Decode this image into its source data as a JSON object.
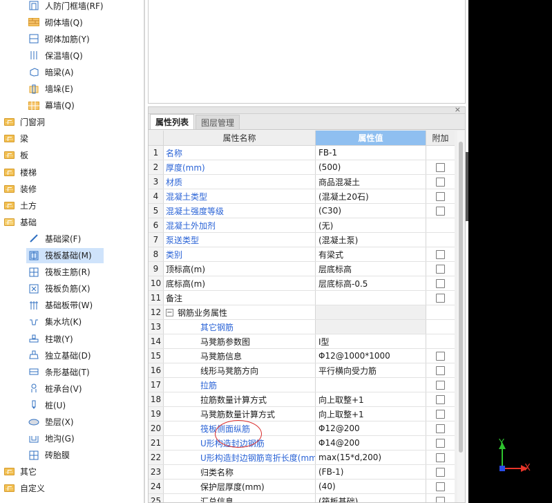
{
  "tree": {
    "items": [
      {
        "label": "人防门框墙(RF)",
        "icon": "door-frame-wall-icon",
        "level": 2
      },
      {
        "label": "砌体墙(Q)",
        "icon": "brick-wall-icon",
        "level": 2
      },
      {
        "label": "砌体加筋(Y)",
        "icon": "masonry-rebar-icon",
        "level": 2
      },
      {
        "label": "保温墙(Q)",
        "icon": "insulation-wall-icon",
        "level": 2
      },
      {
        "label": "暗梁(A)",
        "icon": "hidden-beam-icon",
        "level": 2
      },
      {
        "label": "墙垛(E)",
        "icon": "wall-pier-icon",
        "level": 2
      },
      {
        "label": "幕墙(Q)",
        "icon": "curtain-wall-icon",
        "level": 2
      },
      {
        "label": "门窗洞",
        "icon": "folder-icon",
        "level": 1
      },
      {
        "label": "梁",
        "icon": "folder-icon",
        "level": 1
      },
      {
        "label": "板",
        "icon": "folder-icon",
        "level": 1
      },
      {
        "label": "楼梯",
        "icon": "folder-icon",
        "level": 1
      },
      {
        "label": "装修",
        "icon": "folder-icon",
        "level": 1
      },
      {
        "label": "土方",
        "icon": "folder-icon",
        "level": 1
      },
      {
        "label": "基础",
        "icon": "folder-open-icon",
        "level": 1
      },
      {
        "label": "基础梁(F)",
        "icon": "foundation-beam-icon",
        "level": 2
      },
      {
        "label": "筏板基础(M)",
        "icon": "raft-foundation-icon",
        "level": 2,
        "selected": true
      },
      {
        "label": "筏板主筋(R)",
        "icon": "raft-main-rebar-icon",
        "level": 2
      },
      {
        "label": "筏板负筋(X)",
        "icon": "raft-negative-rebar-icon",
        "level": 2
      },
      {
        "label": "基础板带(W)",
        "icon": "foundation-strip-icon",
        "level": 2
      },
      {
        "label": "集水坑(K)",
        "icon": "sump-pit-icon",
        "level": 2
      },
      {
        "label": "柱墩(Y)",
        "icon": "column-pier-icon",
        "level": 2
      },
      {
        "label": "独立基础(D)",
        "icon": "isolated-footing-icon",
        "level": 2
      },
      {
        "label": "条形基础(T)",
        "icon": "strip-footing-icon",
        "level": 2
      },
      {
        "label": "桩承台(V)",
        "icon": "pile-cap-icon",
        "level": 2
      },
      {
        "label": "桩(U)",
        "icon": "pile-icon",
        "level": 2
      },
      {
        "label": "垫层(X)",
        "icon": "cushion-layer-icon",
        "level": 2
      },
      {
        "label": "地沟(G)",
        "icon": "trench-icon",
        "level": 2
      },
      {
        "label": "砖胎膜",
        "icon": "brick-mold-icon",
        "level": 2
      },
      {
        "label": "其它",
        "icon": "folder-icon",
        "level": 1
      },
      {
        "label": "自定义",
        "icon": "folder-icon",
        "level": 1
      }
    ]
  },
  "panel": {
    "close_label": "×",
    "tabs": [
      {
        "label": "属性列表",
        "active": true
      },
      {
        "label": "图层管理",
        "active": false
      }
    ],
    "headers": {
      "name": "属性名称",
      "value": "属性值",
      "extra": "附加"
    },
    "rows": [
      {
        "n": "1",
        "name": "名称",
        "value": "FB-1",
        "blue": true,
        "check": false,
        "indent": 0
      },
      {
        "n": "2",
        "name": "厚度(mm)",
        "value": "(500)",
        "blue": true,
        "check": true,
        "indent": 0
      },
      {
        "n": "3",
        "name": "材质",
        "value": "商品混凝土",
        "blue": true,
        "check": true,
        "indent": 0
      },
      {
        "n": "4",
        "name": "混凝土类型",
        "value": "(混凝土20石)",
        "blue": true,
        "check": true,
        "indent": 0
      },
      {
        "n": "5",
        "name": "混凝土强度等级",
        "value": "(C30)",
        "blue": true,
        "check": true,
        "indent": 0
      },
      {
        "n": "6",
        "name": "混凝土外加剂",
        "value": "(无)",
        "blue": true,
        "check": false,
        "indent": 0
      },
      {
        "n": "7",
        "name": "泵送类型",
        "value": "(混凝土泵)",
        "blue": true,
        "check": false,
        "indent": 0
      },
      {
        "n": "8",
        "name": "类别",
        "value": "有梁式",
        "blue": true,
        "check": true,
        "indent": 0
      },
      {
        "n": "9",
        "name": "顶标高(m)",
        "value": "层底标高",
        "blue": false,
        "check": true,
        "indent": 0
      },
      {
        "n": "10",
        "name": "底标高(m)",
        "value": "层底标高-0.5",
        "blue": false,
        "check": true,
        "indent": 0
      },
      {
        "n": "11",
        "name": "备注",
        "value": "",
        "blue": false,
        "check": true,
        "indent": 0
      },
      {
        "n": "12",
        "name": "钢筋业务属性",
        "value": "",
        "blue": false,
        "check": false,
        "indent": 0,
        "group": true,
        "expander": "−"
      },
      {
        "n": "13",
        "name": "其它钢筋",
        "value": "",
        "blue": true,
        "check": false,
        "indent": 2
      },
      {
        "n": "14",
        "name": "马凳筋参数图",
        "value": "Ⅰ型",
        "blue": false,
        "check": false,
        "indent": 2
      },
      {
        "n": "15",
        "name": "马凳筋信息",
        "value": "Φ12@1000*1000",
        "blue": false,
        "check": true,
        "indent": 2
      },
      {
        "n": "16",
        "name": "线形马凳筋方向",
        "value": "平行横向受力筋",
        "blue": false,
        "check": true,
        "indent": 2
      },
      {
        "n": "17",
        "name": "拉筋",
        "value": "",
        "blue": true,
        "check": true,
        "indent": 2
      },
      {
        "n": "18",
        "name": "拉筋数量计算方式",
        "value": "向上取整+1",
        "blue": false,
        "check": true,
        "indent": 2
      },
      {
        "n": "19",
        "name": "马凳筋数量计算方式",
        "value": "向上取整+1",
        "blue": false,
        "check": true,
        "indent": 2
      },
      {
        "n": "20",
        "name": "筏板侧面纵筋",
        "value": "Φ12@200",
        "blue": true,
        "check": true,
        "indent": 2
      },
      {
        "n": "21",
        "name": "U形构造封边钢筋",
        "value": "Φ14@200",
        "blue": true,
        "check": true,
        "indent": 2
      },
      {
        "n": "22",
        "name": "U形构造封边钢筋弯折长度(mm)",
        "value": "max(15*d,200)",
        "blue": true,
        "check": true,
        "indent": 2
      },
      {
        "n": "23",
        "name": "归类名称",
        "value": "(FB-1)",
        "blue": false,
        "check": true,
        "indent": 2
      },
      {
        "n": "24",
        "name": "保护层厚度(mm)",
        "value": "(40)",
        "blue": false,
        "check": true,
        "indent": 2
      },
      {
        "n": "25",
        "name": "汇总信息",
        "value": "(筏板基础)",
        "blue": false,
        "check": true,
        "indent": 2
      }
    ]
  },
  "viewport": {
    "axis_y_label": "Y",
    "axis_x_label": "X",
    "colors": {
      "x_axis": "#e8352a",
      "y_axis": "#2ec42e",
      "origin": "#2a4de8",
      "background": "#000000"
    }
  }
}
